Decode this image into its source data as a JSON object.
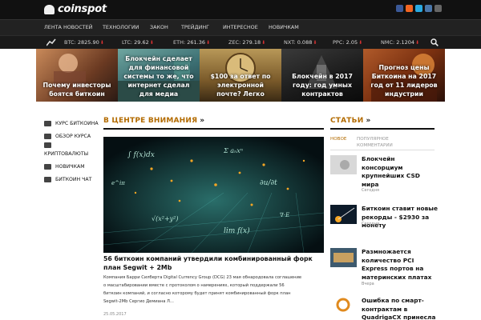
{
  "brand": {
    "logo_text": "coinspot"
  },
  "social_icons": [
    "facebook-icon",
    "rss-icon",
    "twitter-icon",
    "vk-icon",
    "google-plus-icon"
  ],
  "nav": {
    "items": [
      "ЛЕНТА НОВОСТЕЙ",
      "ТЕХНОЛОГИИ",
      "ЗАКОН",
      "ТРЕЙДИНГ",
      "ИНТЕРЕСНОЕ",
      "НОВИЧКАМ"
    ]
  },
  "ticker": [
    {
      "label": "BTC:",
      "value": "2825.90"
    },
    {
      "label": "LTC:",
      "value": "29.62"
    },
    {
      "label": "ETH:",
      "value": "261.36"
    },
    {
      "label": "ZEC:",
      "value": "279.18"
    },
    {
      "label": "NXT:",
      "value": "0.088"
    },
    {
      "label": "PPC:",
      "value": "2.05"
    },
    {
      "label": "NMC:",
      "value": "2.1204"
    }
  ],
  "slides": [
    {
      "caption": "Почему инвесторы боятся биткоин"
    },
    {
      "caption": "Блокчейн сделает для финансовой системы то же, что интернет сделал для медиа"
    },
    {
      "caption": "$100 за ответ по электронной почте? Легко"
    },
    {
      "caption": "Блокчейн в 2017 году: год умных контрактов"
    },
    {
      "caption": "Прогноз цены Биткоина на 2017 год от 11 лидеров индустрии"
    }
  ],
  "sidebar": {
    "items": [
      "КУРС БИТКОИНА",
      "ОБЗОР КУРСА",
      "КРИПТОВАЛЮТЫ",
      "НОВИЧКАМ",
      "БИТКОИН ЧАТ"
    ]
  },
  "center": {
    "heading": "В ЦЕНТРЕ ВНИМАНИЯ",
    "chevron": "»",
    "title": "56 биткоин компаний утвердили комбинированный форк план Segwit + 2Mb",
    "desc": "Компания Барри Силберта Digital Currency Group (DCG) 23 мая обнародовала соглашение о масштабировании вместе с протоколом о намерениях, который поддержали 56 биткоин компаний, и согласно которому будет принят комбинированный форк план Segwit-2Mb Сергио Демиана Л...",
    "date": "25.05.2017"
  },
  "articles_section": {
    "heading": "СТАТЬИ",
    "chevron": "»",
    "tab_new": "НОВОЕ",
    "tab_popular": "ПОПУЛЯРНОЕ",
    "tab_comments": "КОММЕНТАРИИ",
    "items": [
      {
        "title": "Блокчейн консорциум крупнейших CSD мира",
        "date": "Сегодня"
      },
      {
        "title": "Биткоин ставит новые рекорды - $2930 за монету",
        "date": "Сегодня"
      },
      {
        "title": "Размножается количество PCI Express портов на материнских платах",
        "date": "Вчера"
      },
      {
        "title": "Ошибка по смарт-контрактам в QuadrigaCX принесла",
        "date": ""
      }
    ]
  },
  "colors": {
    "accent": "#b36b00",
    "ticker_down": "#dd3333",
    "bar_bg": "#111111"
  }
}
